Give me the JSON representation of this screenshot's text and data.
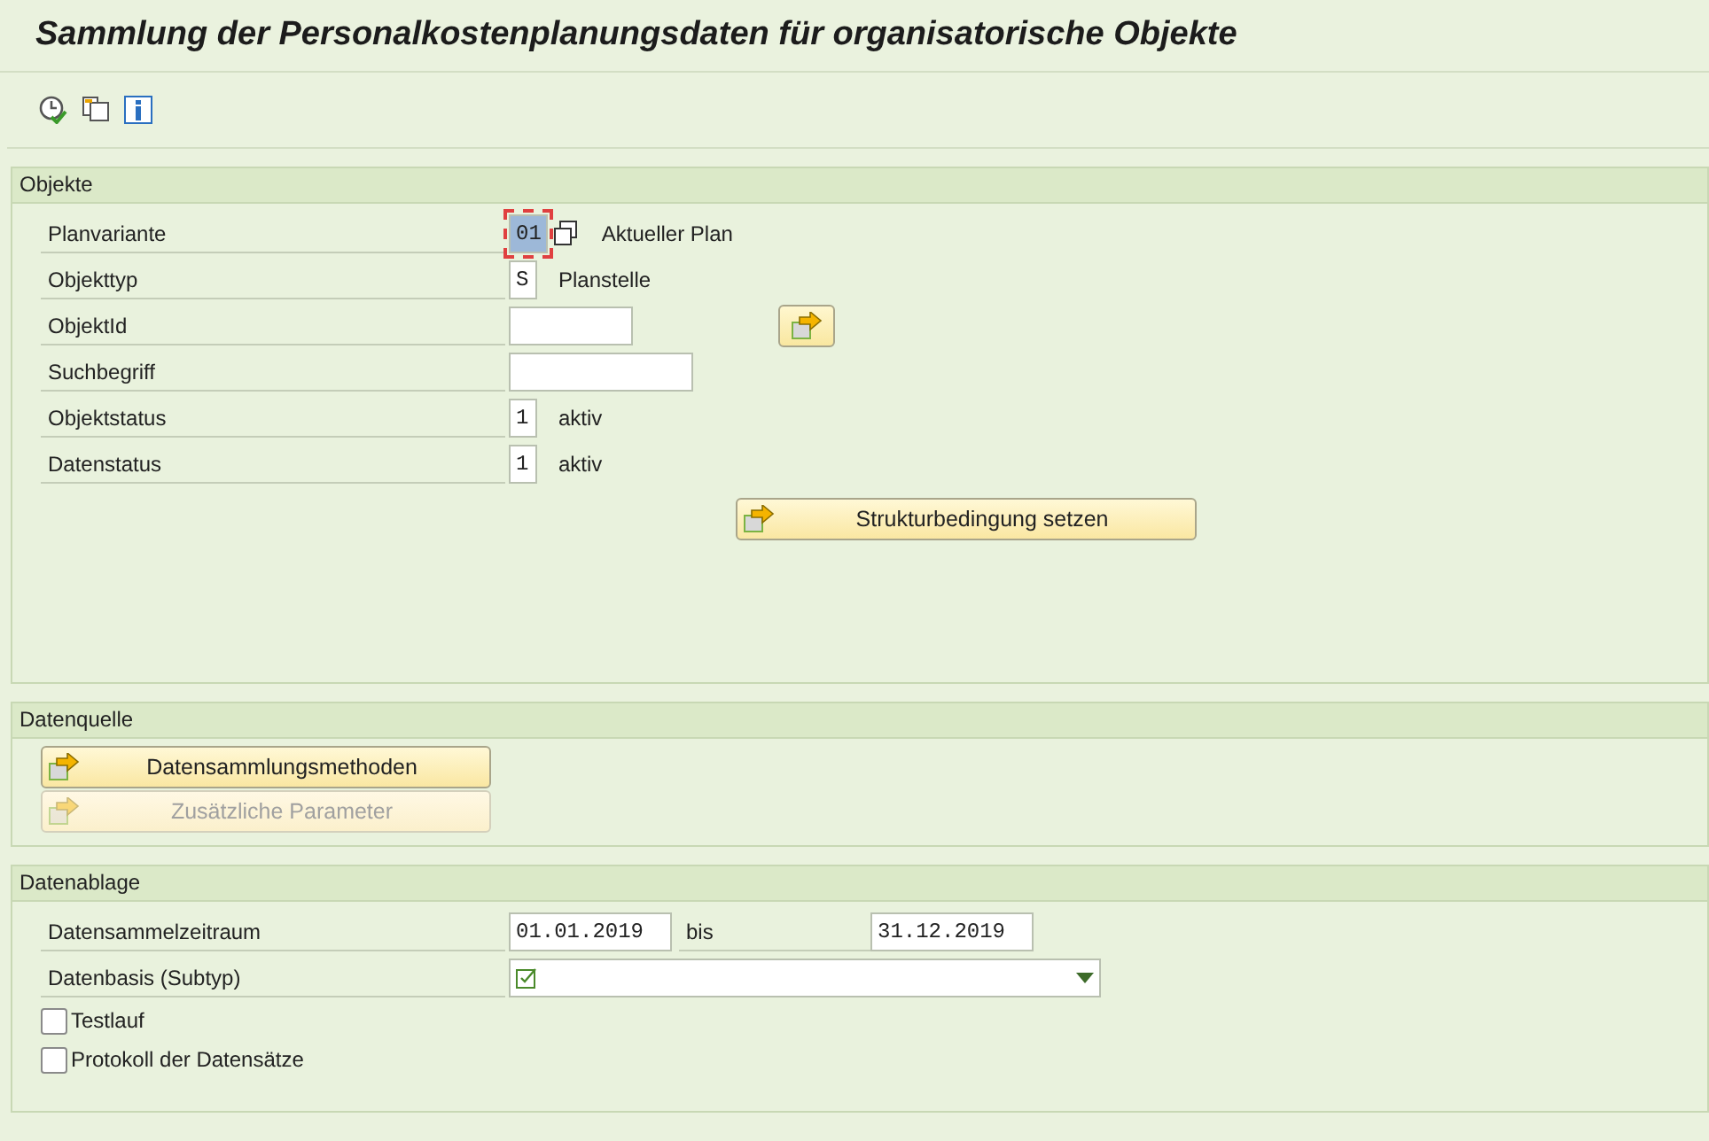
{
  "window": {
    "title": "Sammlung der Personalkostenplanungsdaten für organisatorische Objekte"
  },
  "toolbar": [
    {
      "kind": "execute"
    },
    {
      "kind": "copy"
    },
    {
      "kind": "info"
    }
  ],
  "objects": {
    "title": "Objekte",
    "rows": [
      {
        "label": "Planvariante",
        "value": "01",
        "kind": "code",
        "focused": true,
        "help": true,
        "description": "Aktueller Plan"
      },
      {
        "label": "Objekttyp",
        "value": "S",
        "kind": "code",
        "description": "Planstelle"
      },
      {
        "label": "ObjektId",
        "kind": "id",
        "button": true
      },
      {
        "label": "Suchbegriff",
        "kind": "search"
      },
      {
        "label": "Objektstatus",
        "value": "1",
        "kind": "code",
        "description": "aktiv"
      },
      {
        "label": "Datenstatus",
        "value": "1",
        "kind": "code",
        "description": "aktiv"
      }
    ],
    "structure_button": "Strukturbedingung setzen"
  },
  "source": {
    "title": "Datenquelle",
    "buttons": [
      {
        "label": "Datensammlungsmethoden",
        "disabled": false
      },
      {
        "label": "Zusätzliche Parameter",
        "disabled": true
      }
    ]
  },
  "storage": {
    "title": "Datenablage",
    "period": {
      "label": "Datensammelzeitraum",
      "from": "01.01.2019",
      "separator": "bis",
      "to": "31.12.2019"
    },
    "basis": {
      "label": "Datenbasis (Subtyp)"
    },
    "checkboxes": [
      {
        "label": "Testlauf",
        "checked": false
      },
      {
        "label": "Protokoll der Datensätze",
        "checked": false
      }
    ]
  }
}
